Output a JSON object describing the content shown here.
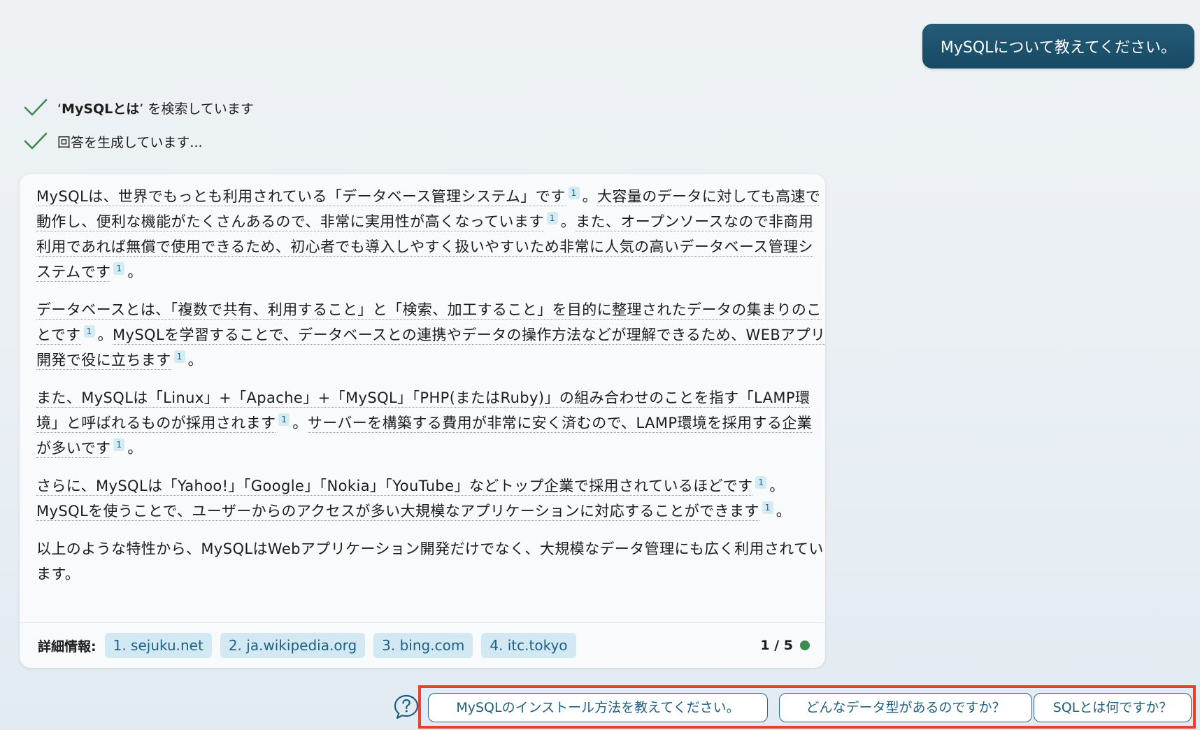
{
  "user_message": "MySQLについて教えてください。",
  "status": {
    "search_query": "MySQLとは",
    "search_suffix": "を検索しています",
    "generating": "回答を生成しています..."
  },
  "answer": {
    "paragraphs": [
      [
        {
          "t": "MySQLは、世界でもっとも利用されている「データベース管理システム」です",
          "u": true
        },
        {
          "cite": "1"
        },
        {
          "t": "。",
          "u": false
        },
        {
          "t": "大容量のデータに対しても高速で動作し、便利な機能がたくさんあるので、非常に実用性が高くなっています",
          "u": true
        },
        {
          "cite": "1"
        },
        {
          "t": "。",
          "u": false
        },
        {
          "t": "また、オープンソースなので非商用利用であれば無償で使用できるため、初心者でも導入しやすく扱いやすいため非常に人気の高いデータベース管理システムです",
          "u": true
        },
        {
          "cite": "1"
        },
        {
          "t": "。",
          "u": false
        }
      ],
      [
        {
          "t": "データベースとは、「複数で共有、利用すること」と「検索、加工すること」を目的に整理されたデータの集まりのことです",
          "u": true
        },
        {
          "cite": "1"
        },
        {
          "t": "。",
          "u": false
        },
        {
          "t": "MySQLを学習することで、データベースとの連携やデータの操作方法などが理解できるため、WEBアプリ開発で役に立ちます",
          "u": true
        },
        {
          "cite": "1"
        },
        {
          "t": "。",
          "u": false
        }
      ],
      [
        {
          "t": "また、MySQLは「Linux」+「Apache」+「MySQL」「PHP(またはRuby)」の組み合わせのことを指す「LAMP環境」と呼ばれるものが採用されます",
          "u": true
        },
        {
          "cite": "1"
        },
        {
          "t": "。",
          "u": false
        },
        {
          "t": "サーバーを構築する費用が非常に安く済むので、LAMP環境を採用する企業が多いです",
          "u": true
        },
        {
          "cite": "1"
        },
        {
          "t": "。",
          "u": false
        }
      ],
      [
        {
          "t": "さらに、MySQLは「Yahoo!」「Google」「Nokia」「YouTube」などトップ企業で採用されているほどです",
          "u": true
        },
        {
          "cite": "1"
        },
        {
          "t": "。",
          "u": false
        },
        {
          "t": "MySQLを使うことで、ユーザーからのアクセスが多い大規模なアプリケーションに対応することができます",
          "u": true
        },
        {
          "cite": "1"
        },
        {
          "t": "。",
          "u": false
        }
      ],
      [
        {
          "t": "以上のような特性から、MySQLはWebアプリケーション開発だけでなく、大規模なデータ管理にも広く利用されています。",
          "u": false
        }
      ]
    ]
  },
  "footer": {
    "label": "詳細情報:",
    "sources": [
      "1. sejuku.net",
      "2. ja.wikipedia.org",
      "3. bing.com",
      "4. itc.tokyo"
    ],
    "page_indicator": "1 / 5",
    "indicator_color": "#3e8a4f"
  },
  "suggestions": [
    "MySQLのインストール方法を教えてください。",
    "どんなデータ型があるのですか？",
    "SQLとは何ですか？"
  ],
  "colors": {
    "user_bubble": "#1f536d",
    "check": "#3e8a4f",
    "accent": "#1f5f82",
    "highlight_border": "#e8412c"
  }
}
